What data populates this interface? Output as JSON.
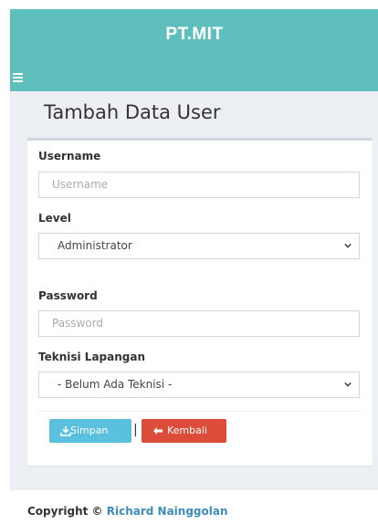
{
  "app": {
    "brand": "PT.MIT"
  },
  "page": {
    "title": "Tambah Data User"
  },
  "form": {
    "username": {
      "label": "Username",
      "placeholder": "Username",
      "value": ""
    },
    "level": {
      "label": "Level",
      "selected": "Administrator"
    },
    "password": {
      "label": "Password",
      "placeholder": "Password",
      "value": ""
    },
    "teknisi": {
      "label": "Teknisi Lapangan",
      "selected": "- Belum Ada Teknisi -"
    }
  },
  "actions": {
    "save_label": "Simpan",
    "divider": "|",
    "back_label": "Kembali"
  },
  "footer": {
    "prefix": "Copyright ©",
    "author": "Richard Nainggolan"
  },
  "colors": {
    "header": "#5fbfbd",
    "content_bg": "#ecf0f5",
    "save_button": "#5bc0de",
    "back_button": "#dd4b39",
    "link": "#3c8dbc"
  },
  "icons": {
    "menu": "hamburger-icon",
    "select": "chevron-down-icon",
    "save": "download-icon",
    "back": "arrow-left-icon"
  }
}
